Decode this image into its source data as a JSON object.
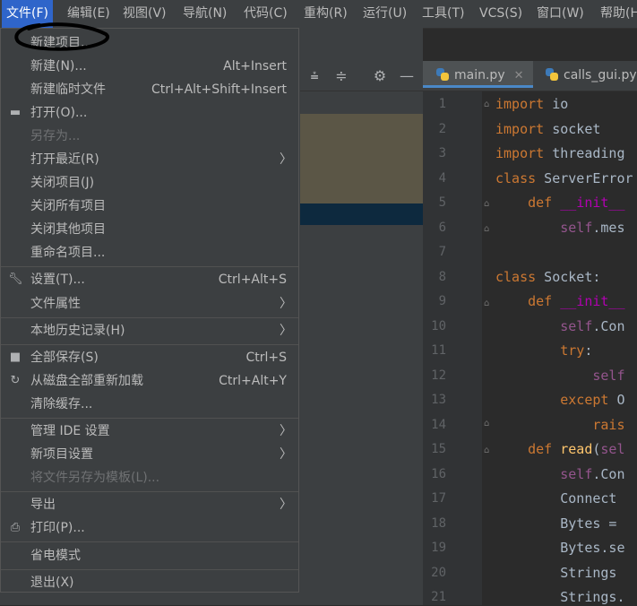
{
  "menubar": {
    "items": [
      "文件(F)",
      "编辑(E)",
      "视图(V)",
      "导航(N)",
      "代码(C)",
      "重构(R)",
      "运行(U)",
      "工具(T)",
      "VCS(S)",
      "窗口(W)",
      "帮助(H)"
    ]
  },
  "file_menu": {
    "items": [
      {
        "label": "新建项目...",
        "shortcut": "",
        "submenu": false,
        "disabled": false,
        "icon": ""
      },
      {
        "label": "新建(N)...",
        "shortcut": "Alt+Insert",
        "submenu": false,
        "disabled": false,
        "icon": ""
      },
      {
        "label": "新建临时文件",
        "shortcut": "Ctrl+Alt+Shift+Insert",
        "submenu": false,
        "disabled": false,
        "icon": ""
      },
      {
        "label": "打开(O)...",
        "shortcut": "",
        "submenu": false,
        "disabled": false,
        "icon": "folder-icon"
      },
      {
        "label": "另存为...",
        "shortcut": "",
        "submenu": false,
        "disabled": true,
        "icon": ""
      },
      {
        "label": "打开最近(R)",
        "shortcut": "",
        "submenu": true,
        "disabled": false,
        "icon": ""
      },
      {
        "label": "关闭项目(J)",
        "shortcut": "",
        "submenu": false,
        "disabled": false,
        "icon": ""
      },
      {
        "label": "关闭所有项目",
        "shortcut": "",
        "submenu": false,
        "disabled": false,
        "icon": ""
      },
      {
        "label": "关闭其他项目",
        "shortcut": "",
        "submenu": false,
        "disabled": false,
        "icon": ""
      },
      {
        "label": "重命名项目...",
        "shortcut": "",
        "submenu": false,
        "disabled": false,
        "icon": ""
      },
      {
        "label": "设置(T)...",
        "shortcut": "Ctrl+Alt+S",
        "submenu": false,
        "disabled": false,
        "icon": "wrench-icon"
      },
      {
        "label": "文件属性",
        "shortcut": "",
        "submenu": true,
        "disabled": false,
        "icon": ""
      },
      {
        "label": "本地历史记录(H)",
        "shortcut": "",
        "submenu": true,
        "disabled": false,
        "icon": ""
      },
      {
        "label": "全部保存(S)",
        "shortcut": "Ctrl+S",
        "submenu": false,
        "disabled": false,
        "icon": "save-icon"
      },
      {
        "label": "从磁盘全部重新加载",
        "shortcut": "Ctrl+Alt+Y",
        "submenu": false,
        "disabled": false,
        "icon": "reload-icon"
      },
      {
        "label": "清除缓存...",
        "shortcut": "",
        "submenu": false,
        "disabled": false,
        "icon": ""
      },
      {
        "label": "管理 IDE 设置",
        "shortcut": "",
        "submenu": true,
        "disabled": false,
        "icon": ""
      },
      {
        "label": "新项目设置",
        "shortcut": "",
        "submenu": true,
        "disabled": false,
        "icon": ""
      },
      {
        "label": "将文件另存为模板(L)...",
        "shortcut": "",
        "submenu": false,
        "disabled": true,
        "icon": ""
      },
      {
        "label": "导出",
        "shortcut": "",
        "submenu": true,
        "disabled": false,
        "icon": ""
      },
      {
        "label": "打印(P)...",
        "shortcut": "",
        "submenu": false,
        "disabled": false,
        "icon": "print-icon"
      },
      {
        "label": "省电模式",
        "shortcut": "",
        "submenu": false,
        "disabled": false,
        "icon": ""
      },
      {
        "label": "退出(X)",
        "shortcut": "",
        "submenu": false,
        "disabled": false,
        "icon": ""
      }
    ]
  },
  "editor": {
    "tabs": [
      "main.py",
      "calls_gui.py"
    ],
    "line_numbers": [
      "1",
      "2",
      "3",
      "4",
      "5",
      "6",
      "7",
      "8",
      "9",
      "10",
      "11",
      "12",
      "13",
      "14",
      "15",
      "16",
      "17",
      "18",
      "19",
      "20",
      "21"
    ]
  },
  "colors": {
    "menu_bg": "#3c3f41",
    "highlight": "#2f65ca",
    "editor_bg": "#2b2b2b",
    "keyword": "#cc7832"
  }
}
